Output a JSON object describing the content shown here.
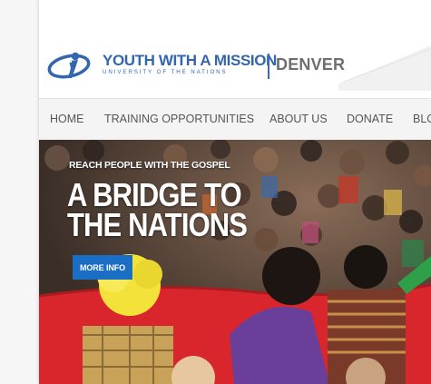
{
  "brand": {
    "title": "YOUTH WITH A MISSION",
    "subtitle": "UNIVERSITY OF THE NATIONS",
    "location": "DENVER",
    "color": "#3466b0"
  },
  "nav": {
    "items": [
      {
        "label": "HOME"
      },
      {
        "label": "TRAINING OPPORTUNITIES"
      },
      {
        "label": "ABOUT US"
      },
      {
        "label": "DONATE"
      },
      {
        "label": "BLO"
      }
    ]
  },
  "hero": {
    "kicker": "REACH PEOPLE WITH THE GOSPEL",
    "headline_line1": "A BRIDGE TO",
    "headline_line2": "THE NATIONS",
    "button_label": "MORE INFO",
    "button_color": "#1a6fc4"
  }
}
